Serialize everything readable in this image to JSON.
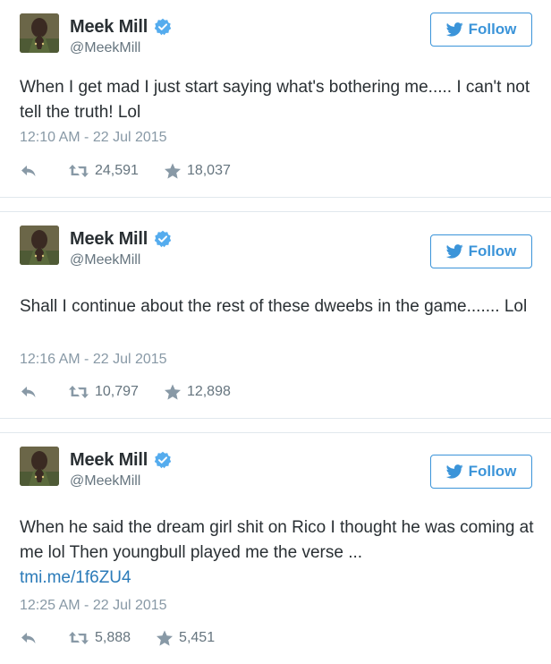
{
  "colors": {
    "accent": "#3b94d9",
    "link": "#2b7bb9",
    "muted": "#8899a6"
  },
  "tweets": [
    {
      "name": "Meek Mill",
      "handle": "@MeekMill",
      "follow_label": "Follow",
      "text": "When I get mad I just start saying what's bothering me..... I can't not tell the truth! Lol",
      "link": "",
      "timestamp": "12:10 AM - 22 Jul 2015",
      "retweets": "24,591",
      "favorites": "18,037"
    },
    {
      "name": "Meek Mill",
      "handle": "@MeekMill",
      "follow_label": "Follow",
      "text": "Shall I continue about the rest of these dweebs in the game....... Lol",
      "link": "",
      "timestamp": "12:16 AM - 22 Jul 2015",
      "retweets": "10,797",
      "favorites": "12,898"
    },
    {
      "name": "Meek Mill",
      "handle": "@MeekMill",
      "follow_label": "Follow",
      "text": "When he said the dream girl shit on Rico I thought he was coming at me lol Then youngbull played me the verse ...",
      "link": "tmi.me/1f6ZU4",
      "timestamp": "12:25 AM - 22 Jul 2015",
      "retweets": "5,888",
      "favorites": "5,451"
    }
  ]
}
